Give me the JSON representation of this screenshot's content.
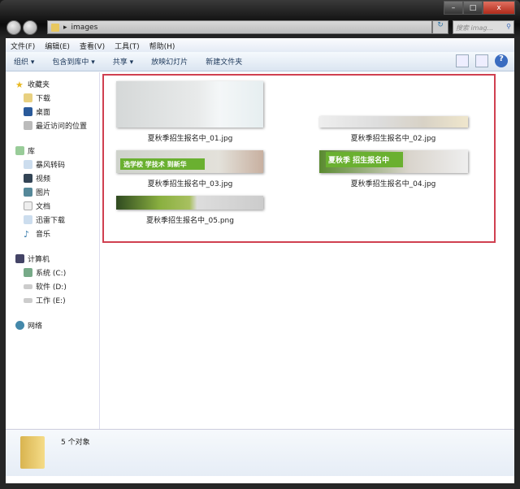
{
  "window": {
    "minimize": "–",
    "maximize": "□",
    "close": "x"
  },
  "address": {
    "path": "images",
    "search_placeholder": "搜索 imag...",
    "refresh": "↻"
  },
  "menu": [
    "文件(F)",
    "编辑(E)",
    "查看(V)",
    "工具(T)",
    "帮助(H)"
  ],
  "toolbar": [
    "组织 ▾",
    "包含到库中 ▾",
    "共享 ▾",
    "放映幻灯片",
    "新建文件夹"
  ],
  "sidebar": {
    "favorites": {
      "label": "收藏夹",
      "items": [
        "下载",
        "桌面",
        "最近访问的位置"
      ]
    },
    "libraries": {
      "label": "库",
      "items": [
        "暴风转码",
        "视频",
        "图片",
        "文档",
        "迅雷下载",
        "音乐"
      ]
    },
    "computer": {
      "label": "计算机",
      "items": [
        "系统 (C:)",
        "软件 (D:)",
        "工作 (E:)"
      ]
    },
    "network": {
      "label": "网络"
    }
  },
  "files": [
    {
      "name": "夏秋季招生报名中_01.jpg"
    },
    {
      "name": "夏秋季招生报名中_02.jpg"
    },
    {
      "name": "夏秋季招生报名中_03.jpg",
      "banner": "选学校 学技术 到新华"
    },
    {
      "name": "夏秋季招生报名中_04.jpg",
      "banner": "夏秋季 招生报名中"
    },
    {
      "name": "夏秋季招生报名中_05.png"
    }
  ],
  "status": {
    "count": "5 个对象"
  }
}
